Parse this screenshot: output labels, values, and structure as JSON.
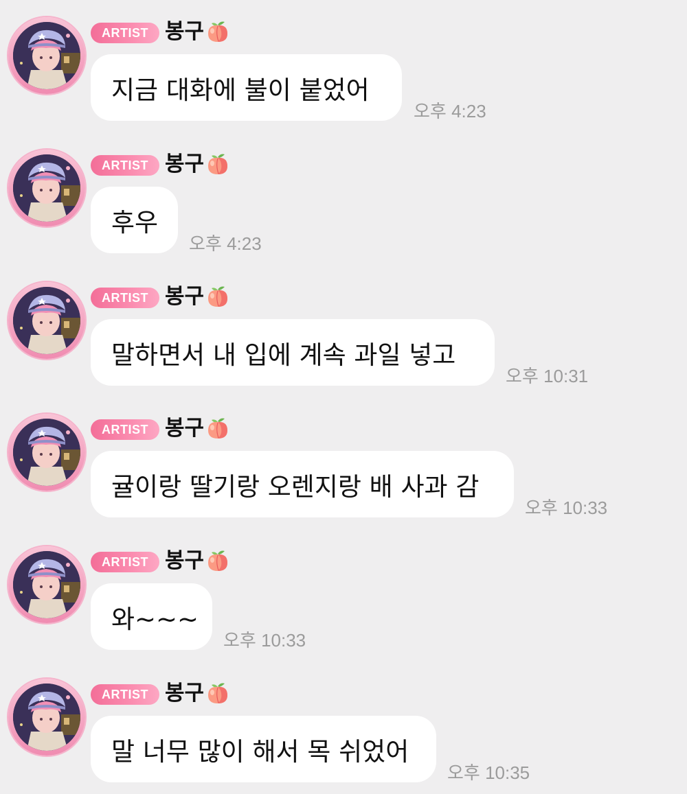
{
  "messages": [
    {
      "badge": "ARTIST",
      "sender": "봉구",
      "sender_emoji": "peach-emoji",
      "text": "지금 대화에 불이 붙었어",
      "time": "오후 4:23"
    },
    {
      "badge": "ARTIST",
      "sender": "봉구",
      "sender_emoji": "peach-emoji",
      "text": "후우",
      "time": "오후 4:23"
    },
    {
      "badge": "ARTIST",
      "sender": "봉구",
      "sender_emoji": "peach-emoji",
      "text": "말하면서 내 입에 계속 과일 넣고",
      "time": "오후 10:31"
    },
    {
      "badge": "ARTIST",
      "sender": "봉구",
      "sender_emoji": "peach-emoji",
      "text": "귤이랑 딸기랑 오렌지랑 배 사과 감",
      "time": "오후 10:33"
    },
    {
      "badge": "ARTIST",
      "sender": "봉구",
      "sender_emoji": "peach-emoji",
      "text": "와~~~",
      "time": "오후 10:33"
    },
    {
      "badge": "ARTIST",
      "sender": "봉구",
      "sender_emoji": "peach-emoji",
      "text": "말 너무 많이 해서 목 쉬었어",
      "time": "오후 10:35"
    }
  ],
  "colors": {
    "background": "#efeeef",
    "bubble": "#ffffff",
    "badge_start": "#f36e98",
    "badge_end": "#fda7c3",
    "avatar_ring": "#f08cb1",
    "time_text": "#9b9b9b"
  }
}
